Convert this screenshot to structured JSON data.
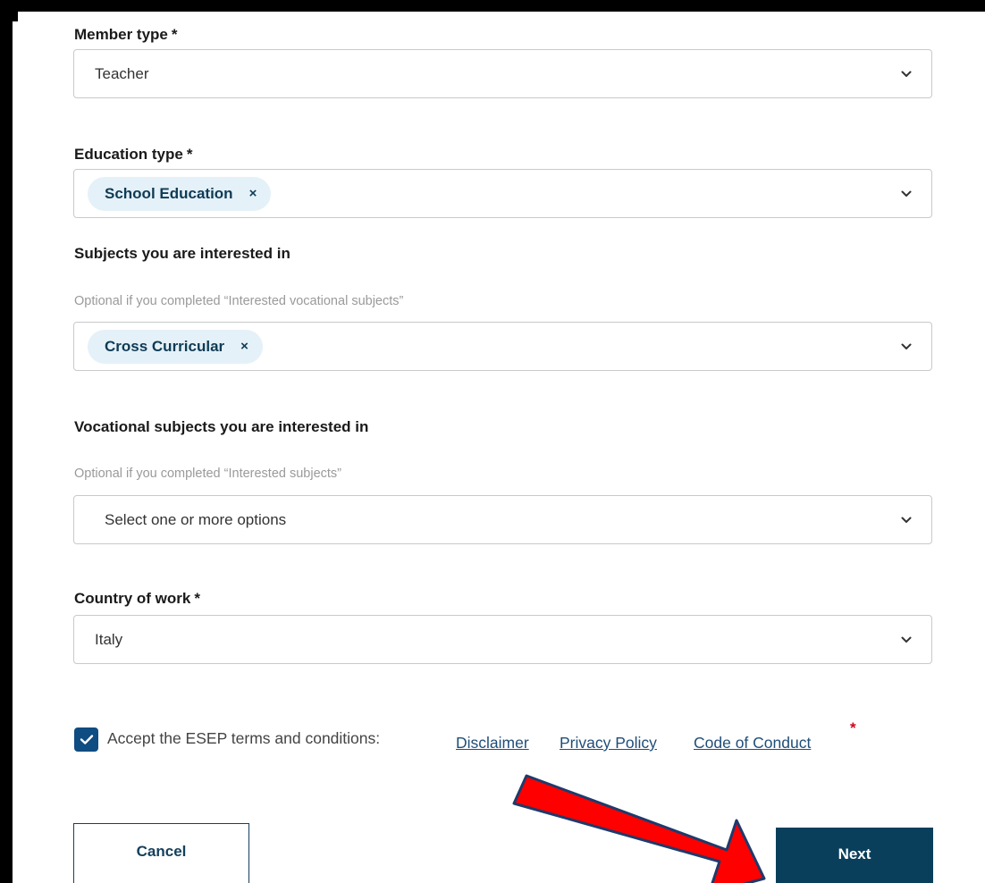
{
  "form": {
    "member_type": {
      "label": "Member type",
      "required_mark": "*",
      "value": "Teacher"
    },
    "education_type": {
      "label": "Education type",
      "required_mark": "*",
      "chips": [
        {
          "label": "School Education",
          "remove": "×"
        }
      ]
    },
    "subjects": {
      "label": "Subjects you are interested in",
      "helper": "Optional if you completed “Interested vocational subjects”",
      "chips": [
        {
          "label": "Cross Curricular",
          "remove": "×"
        }
      ]
    },
    "vocational_subjects": {
      "label": "Vocational subjects you are interested in",
      "helper": "Optional if you completed “Interested subjects”",
      "placeholder": "Select one or more options"
    },
    "country": {
      "label": "Country of work",
      "required_mark": "*",
      "value": "Italy"
    },
    "terms": {
      "checked": true,
      "text": "Accept the ESEP terms and conditions:",
      "links": [
        "Disclaimer",
        "Privacy Policy",
        "Code of Conduct"
      ],
      "required_mark": "*"
    },
    "buttons": {
      "cancel": "Cancel",
      "next": "Next"
    }
  },
  "colors": {
    "chip_bg": "#e5f1f8",
    "chip_text": "#0e3b55",
    "primary_button": "#0a3f5c",
    "checkbox": "#0f4c81",
    "link": "#1f4e79",
    "required_star": "#d0021b",
    "annotation_arrow": "#ff0000"
  }
}
